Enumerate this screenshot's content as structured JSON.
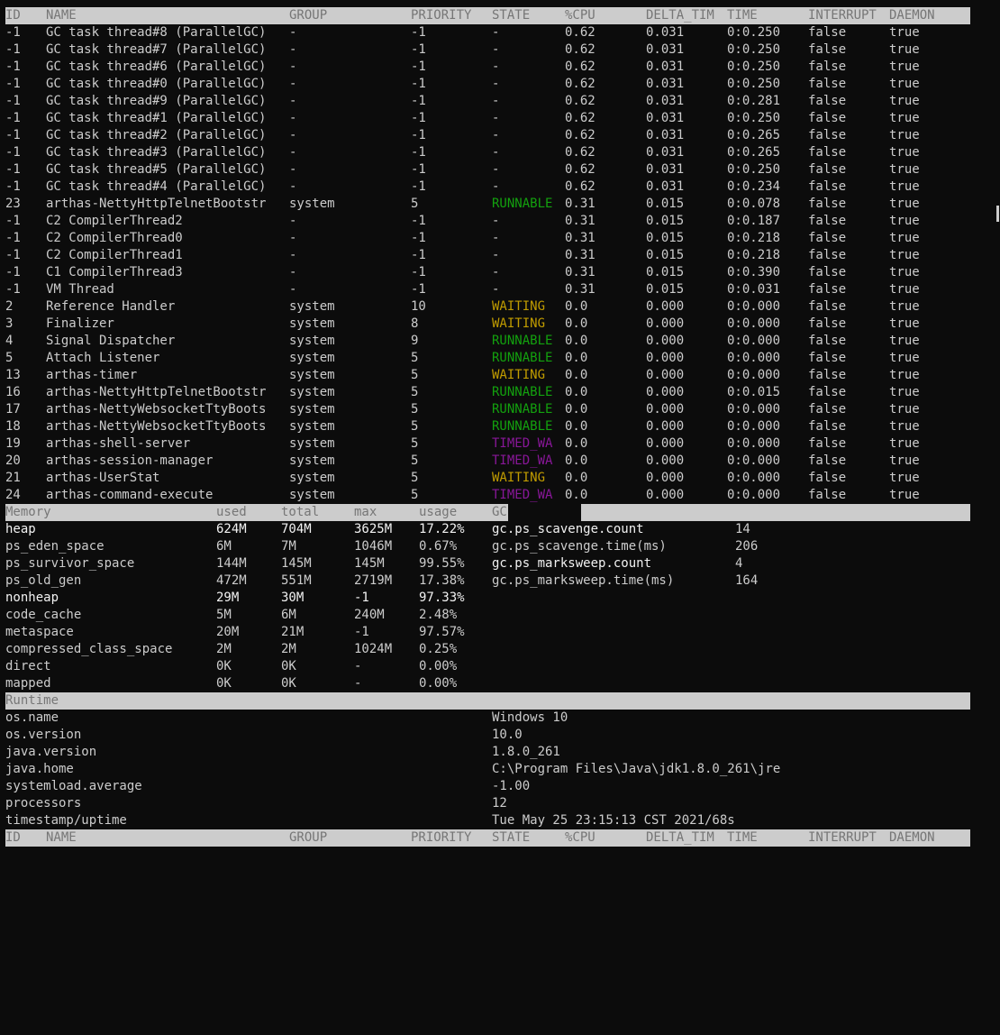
{
  "thread_headers": [
    "ID",
    "NAME",
    "GROUP",
    "PRIORITY",
    "STATE",
    "%CPU",
    "DELTA_TIM",
    "TIME",
    "INTERRUPT",
    "DAEMON"
  ],
  "threads": [
    {
      "id": "-1",
      "name": "GC task thread#8 (ParallelGC)",
      "group": "-",
      "priority": "-1",
      "state": "-",
      "state_color": "none",
      "cpu": "0.62",
      "delta": "0.031",
      "time": "0:0.250",
      "interrupt": "false",
      "daemon": "true"
    },
    {
      "id": "-1",
      "name": "GC task thread#7 (ParallelGC)",
      "group": "-",
      "priority": "-1",
      "state": "-",
      "state_color": "none",
      "cpu": "0.62",
      "delta": "0.031",
      "time": "0:0.250",
      "interrupt": "false",
      "daemon": "true"
    },
    {
      "id": "-1",
      "name": "GC task thread#6 (ParallelGC)",
      "group": "-",
      "priority": "-1",
      "state": "-",
      "state_color": "none",
      "cpu": "0.62",
      "delta": "0.031",
      "time": "0:0.250",
      "interrupt": "false",
      "daemon": "true"
    },
    {
      "id": "-1",
      "name": "GC task thread#0 (ParallelGC)",
      "group": "-",
      "priority": "-1",
      "state": "-",
      "state_color": "none",
      "cpu": "0.62",
      "delta": "0.031",
      "time": "0:0.250",
      "interrupt": "false",
      "daemon": "true"
    },
    {
      "id": "-1",
      "name": "GC task thread#9 (ParallelGC)",
      "group": "-",
      "priority": "-1",
      "state": "-",
      "state_color": "none",
      "cpu": "0.62",
      "delta": "0.031",
      "time": "0:0.281",
      "interrupt": "false",
      "daemon": "true"
    },
    {
      "id": "-1",
      "name": "GC task thread#1 (ParallelGC)",
      "group": "-",
      "priority": "-1",
      "state": "-",
      "state_color": "none",
      "cpu": "0.62",
      "delta": "0.031",
      "time": "0:0.250",
      "interrupt": "false",
      "daemon": "true"
    },
    {
      "id": "-1",
      "name": "GC task thread#2 (ParallelGC)",
      "group": "-",
      "priority": "-1",
      "state": "-",
      "state_color": "none",
      "cpu": "0.62",
      "delta": "0.031",
      "time": "0:0.265",
      "interrupt": "false",
      "daemon": "true"
    },
    {
      "id": "-1",
      "name": "GC task thread#3 (ParallelGC)",
      "group": "-",
      "priority": "-1",
      "state": "-",
      "state_color": "none",
      "cpu": "0.62",
      "delta": "0.031",
      "time": "0:0.265",
      "interrupt": "false",
      "daemon": "true"
    },
    {
      "id": "-1",
      "name": "GC task thread#5 (ParallelGC)",
      "group": "-",
      "priority": "-1",
      "state": "-",
      "state_color": "none",
      "cpu": "0.62",
      "delta": "0.031",
      "time": "0:0.250",
      "interrupt": "false",
      "daemon": "true"
    },
    {
      "id": "-1",
      "name": "GC task thread#4 (ParallelGC)",
      "group": "-",
      "priority": "-1",
      "state": "-",
      "state_color": "none",
      "cpu": "0.62",
      "delta": "0.031",
      "time": "0:0.234",
      "interrupt": "false",
      "daemon": "true"
    },
    {
      "id": "23",
      "name": "arthas-NettyHttpTelnetBootstr",
      "group": "system",
      "priority": "5",
      "state": "RUNNABLE",
      "state_color": "green",
      "cpu": "0.31",
      "delta": "0.015",
      "time": "0:0.078",
      "interrupt": "false",
      "daemon": "true"
    },
    {
      "id": "-1",
      "name": "C2 CompilerThread2",
      "group": "-",
      "priority": "-1",
      "state": "-",
      "state_color": "none",
      "cpu": "0.31",
      "delta": "0.015",
      "time": "0:0.187",
      "interrupt": "false",
      "daemon": "true"
    },
    {
      "id": "-1",
      "name": "C2 CompilerThread0",
      "group": "-",
      "priority": "-1",
      "state": "-",
      "state_color": "none",
      "cpu": "0.31",
      "delta": "0.015",
      "time": "0:0.218",
      "interrupt": "false",
      "daemon": "true"
    },
    {
      "id": "-1",
      "name": "C2 CompilerThread1",
      "group": "-",
      "priority": "-1",
      "state": "-",
      "state_color": "none",
      "cpu": "0.31",
      "delta": "0.015",
      "time": "0:0.218",
      "interrupt": "false",
      "daemon": "true"
    },
    {
      "id": "-1",
      "name": "C1 CompilerThread3",
      "group": "-",
      "priority": "-1",
      "state": "-",
      "state_color": "none",
      "cpu": "0.31",
      "delta": "0.015",
      "time": "0:0.390",
      "interrupt": "false",
      "daemon": "true"
    },
    {
      "id": "-1",
      "name": "VM Thread",
      "group": "-",
      "priority": "-1",
      "state": "-",
      "state_color": "none",
      "cpu": "0.31",
      "delta": "0.015",
      "time": "0:0.031",
      "interrupt": "false",
      "daemon": "true"
    },
    {
      "id": "2",
      "name": "Reference Handler",
      "group": "system",
      "priority": "10",
      "state": "WAITING",
      "state_color": "yellow",
      "cpu": "0.0",
      "delta": "0.000",
      "time": "0:0.000",
      "interrupt": "false",
      "daemon": "true"
    },
    {
      "id": "3",
      "name": "Finalizer",
      "group": "system",
      "priority": "8",
      "state": "WAITING",
      "state_color": "yellow",
      "cpu": "0.0",
      "delta": "0.000",
      "time": "0:0.000",
      "interrupt": "false",
      "daemon": "true"
    },
    {
      "id": "4",
      "name": "Signal Dispatcher",
      "group": "system",
      "priority": "9",
      "state": "RUNNABLE",
      "state_color": "green",
      "cpu": "0.0",
      "delta": "0.000",
      "time": "0:0.000",
      "interrupt": "false",
      "daemon": "true"
    },
    {
      "id": "5",
      "name": "Attach Listener",
      "group": "system",
      "priority": "5",
      "state": "RUNNABLE",
      "state_color": "green",
      "cpu": "0.0",
      "delta": "0.000",
      "time": "0:0.000",
      "interrupt": "false",
      "daemon": "true"
    },
    {
      "id": "13",
      "name": "arthas-timer",
      "group": "system",
      "priority": "5",
      "state": "WAITING",
      "state_color": "yellow",
      "cpu": "0.0",
      "delta": "0.000",
      "time": "0:0.000",
      "interrupt": "false",
      "daemon": "true"
    },
    {
      "id": "16",
      "name": "arthas-NettyHttpTelnetBootstr",
      "group": "system",
      "priority": "5",
      "state": "RUNNABLE",
      "state_color": "green",
      "cpu": "0.0",
      "delta": "0.000",
      "time": "0:0.015",
      "interrupt": "false",
      "daemon": "true"
    },
    {
      "id": "17",
      "name": "arthas-NettyWebsocketTtyBoots",
      "group": "system",
      "priority": "5",
      "state": "RUNNABLE",
      "state_color": "green",
      "cpu": "0.0",
      "delta": "0.000",
      "time": "0:0.000",
      "interrupt": "false",
      "daemon": "true"
    },
    {
      "id": "18",
      "name": "arthas-NettyWebsocketTtyBoots",
      "group": "system",
      "priority": "5",
      "state": "RUNNABLE",
      "state_color": "green",
      "cpu": "0.0",
      "delta": "0.000",
      "time": "0:0.000",
      "interrupt": "false",
      "daemon": "true"
    },
    {
      "id": "19",
      "name": "arthas-shell-server",
      "group": "system",
      "priority": "5",
      "state": "TIMED_WA",
      "state_color": "purple",
      "cpu": "0.0",
      "delta": "0.000",
      "time": "0:0.000",
      "interrupt": "false",
      "daemon": "true"
    },
    {
      "id": "20",
      "name": "arthas-session-manager",
      "group": "system",
      "priority": "5",
      "state": "TIMED_WA",
      "state_color": "purple",
      "cpu": "0.0",
      "delta": "0.000",
      "time": "0:0.000",
      "interrupt": "false",
      "daemon": "true"
    },
    {
      "id": "21",
      "name": "arthas-UserStat",
      "group": "system",
      "priority": "5",
      "state": "WAITING",
      "state_color": "yellow",
      "cpu": "0.0",
      "delta": "0.000",
      "time": "0:0.000",
      "interrupt": "false",
      "daemon": "true"
    },
    {
      "id": "24",
      "name": "arthas-command-execute",
      "group": "system",
      "priority": "5",
      "state": "TIMED_WA",
      "state_color": "purple",
      "cpu": "0.0",
      "delta": "0.000",
      "time": "0:0.000",
      "interrupt": "false",
      "daemon": "true"
    }
  ],
  "memory_headers": [
    "Memory",
    "used",
    "total",
    "max",
    "usage"
  ],
  "gc_header": "GC",
  "memory": [
    {
      "name": "heap",
      "used": "624M",
      "total": "704M",
      "max": "3625M",
      "usage": "17.22%",
      "bright": true
    },
    {
      "name": "ps_eden_space",
      "used": "6M",
      "total": "7M",
      "max": "1046M",
      "usage": "0.67%",
      "bright": false
    },
    {
      "name": "ps_survivor_space",
      "used": "144M",
      "total": "145M",
      "max": "145M",
      "usage": "99.55%",
      "bright": false
    },
    {
      "name": "ps_old_gen",
      "used": "472M",
      "total": "551M",
      "max": "2719M",
      "usage": "17.38%",
      "bright": false
    },
    {
      "name": "nonheap",
      "used": "29M",
      "total": "30M",
      "max": "-1",
      "usage": "97.33%",
      "bright": true
    },
    {
      "name": "code_cache",
      "used": "5M",
      "total": "6M",
      "max": "240M",
      "usage": "2.48%",
      "bright": false
    },
    {
      "name": "metaspace",
      "used": "20M",
      "total": "21M",
      "max": "-1",
      "usage": "97.57%",
      "bright": false
    },
    {
      "name": "compressed_class_space",
      "used": "2M",
      "total": "2M",
      "max": "1024M",
      "usage": "0.25%",
      "bright": false
    },
    {
      "name": "direct",
      "used": "0K",
      "total": "0K",
      "max": "-",
      "usage": "0.00%",
      "bright": false
    },
    {
      "name": "mapped",
      "used": "0K",
      "total": "0K",
      "max": "-",
      "usage": "0.00%",
      "bright": false
    }
  ],
  "gc": [
    {
      "name": "gc.ps_scavenge.count",
      "value": "14",
      "bright": true
    },
    {
      "name": "gc.ps_scavenge.time(ms)",
      "value": "206",
      "bright": false
    },
    {
      "name": "gc.ps_marksweep.count",
      "value": "4",
      "bright": true
    },
    {
      "name": "gc.ps_marksweep.time(ms)",
      "value": "164",
      "bright": false
    }
  ],
  "runtime_header": "Runtime",
  "runtime": [
    {
      "name": "os.name",
      "value": "Windows 10"
    },
    {
      "name": "os.version",
      "value": "10.0"
    },
    {
      "name": "java.version",
      "value": "1.8.0_261"
    },
    {
      "name": "java.home",
      "value": "C:\\Program Files\\Java\\jdk1.8.0_261\\jre"
    },
    {
      "name": "systemload.average",
      "value": "-1.00"
    },
    {
      "name": "processors",
      "value": "12"
    },
    {
      "name": "timestamp/uptime",
      "value": "Tue May 25 23:15:13 CST 2021/68s"
    }
  ],
  "colors": {
    "background": "#0c0c0c",
    "text": "#cccccc",
    "header_bg": "#cccccc",
    "header_text": "#767676",
    "runnable": "#13a10e",
    "waiting": "#c19c00",
    "timed_waiting": "#881798"
  }
}
